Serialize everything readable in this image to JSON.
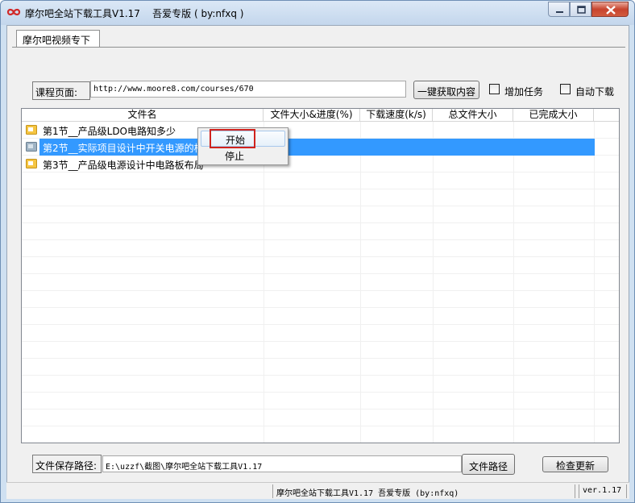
{
  "window": {
    "title": "摩尔吧全站下载工具V1.17    吾爱专版 ( by:nfxq )"
  },
  "tab": {
    "label": "摩尔吧视频专下"
  },
  "course": {
    "label": "课程页面:",
    "url": "http://www.moore8.com/courses/670",
    "fetch_button": "一键获取内容",
    "add_task_label": "增加任务",
    "auto_download_label": "自动下载"
  },
  "table": {
    "columns": [
      "文件名",
      "文件大小&进度(%)",
      "下载速度(k/s)",
      "总文件大小",
      "已完成大小"
    ],
    "rows": [
      {
        "name": "第1节__产品级LDO电路知多少",
        "selected": false
      },
      {
        "name": "第2节__实际项目设计中开关电源的核心技术点",
        "selected": true
      },
      {
        "name": "第3节__产品级电源设计中电路板布局",
        "selected": false
      }
    ]
  },
  "context_menu": {
    "items": [
      "开始",
      "停止"
    ]
  },
  "save": {
    "label": "文件保存路径:",
    "path": "E:\\uzzf\\截图\\摩尔吧全站下载工具V1.17",
    "dir_button": "文件路径",
    "update_button": "检查更新"
  },
  "status": {
    "main": "摩尔吧全站下载工具V1.17    吾爱专版 (by:nfxq)",
    "version": "ver.1.17"
  },
  "colors": {
    "selection": "#3399ff",
    "highlight": "#d0231e"
  }
}
